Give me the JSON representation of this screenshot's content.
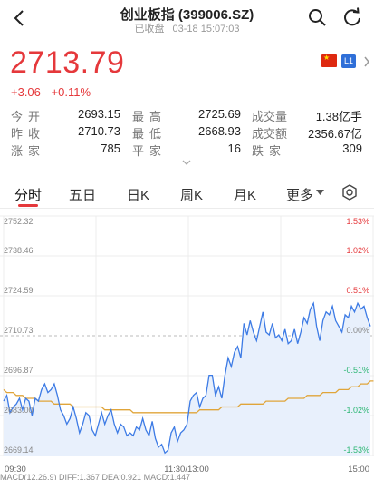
{
  "header": {
    "title": "创业板指 (399006.SZ)",
    "status": "已收盘",
    "datetime": "03-18 15:07:03"
  },
  "quote": {
    "price": "2713.79",
    "change": "+3.06",
    "change_pct": "+0.11%",
    "market_badge": "L1"
  },
  "stats": {
    "open_label": "今开",
    "open": "2693.15",
    "high_label": "最高",
    "high": "2725.69",
    "volume_label": "成交量",
    "volume": "1.38亿手",
    "prev_close_label": "昨收",
    "prev_close": "2710.73",
    "low_label": "最低",
    "low": "2668.93",
    "turnover_label": "成交额",
    "turnover": "2356.67亿",
    "up_label": "涨家",
    "up_count": "785",
    "flat_label": "平家",
    "flat_count": "16",
    "down_label": "跌家",
    "down_count": "309"
  },
  "tabs": [
    "分时",
    "五日",
    "日K",
    "周K",
    "月K",
    "更多"
  ],
  "chart_data": {
    "type": "line",
    "yticks_left": [
      "2752.32",
      "2738.46",
      "2724.59",
      "2710.73",
      "2696.87",
      "2683.00",
      "2669.14"
    ],
    "yticks_right": [
      "1.53%",
      "1.02%",
      "0.51%",
      "0.00%",
      "-0.51%",
      "-1.02%",
      "-1.53%"
    ],
    "xticks": [
      "09:30",
      "11:30/13:00",
      "15:00"
    ],
    "ylim": [
      2669.14,
      2752.32
    ],
    "baseline": 2710.73,
    "series": [
      {
        "values": [
          2688,
          2690,
          2684,
          2686,
          2687,
          2689,
          2685,
          2689,
          2688,
          2683,
          2689,
          2688,
          2692,
          2694,
          2691,
          2692,
          2694,
          2690,
          2685,
          2683,
          2680,
          2682,
          2686,
          2682,
          2677,
          2680,
          2684,
          2683,
          2678,
          2676,
          2680,
          2684,
          2680,
          2683,
          2685,
          2680,
          2677,
          2680,
          2679,
          2676,
          2677,
          2676,
          2679,
          2678,
          2682,
          2678,
          2676,
          2681,
          2675,
          2672,
          2673,
          2670,
          2671,
          2677,
          2679,
          2674,
          2677,
          2678,
          2680,
          2688,
          2690,
          2691,
          2686,
          2689,
          2690,
          2697,
          2697,
          2690,
          2693,
          2689,
          2697,
          2703,
          2700,
          2705,
          2707,
          2703,
          2715,
          2711,
          2716,
          2712,
          2709,
          2714,
          2719,
          2712,
          2711,
          2715,
          2710,
          2711,
          2709,
          2713,
          2708,
          2709,
          2713,
          2708,
          2712,
          2717,
          2715,
          2720,
          2722,
          2714,
          2709,
          2716,
          2719,
          2718,
          2721,
          2716,
          2714,
          2712,
          2718,
          2717,
          2721,
          2719,
          2722,
          2720,
          2721,
          2717,
          2714
        ]
      },
      {
        "values": [
          2692,
          2691,
          2691,
          2691,
          2690,
          2690,
          2690,
          2689,
          2689,
          2689,
          2689,
          2688,
          2688,
          2688,
          2688,
          2688,
          2687,
          2687,
          2687,
          2687,
          2687,
          2687,
          2686,
          2686,
          2686,
          2686,
          2686,
          2686,
          2686,
          2686,
          2686,
          2686,
          2685,
          2685,
          2685,
          2685,
          2685,
          2685,
          2685,
          2685,
          2685,
          2684,
          2684,
          2684,
          2684,
          2684,
          2684,
          2684,
          2684,
          2684,
          2684,
          2684,
          2684,
          2684,
          2684,
          2684,
          2684,
          2684,
          2684,
          2684,
          2684,
          2684,
          2685,
          2685,
          2685,
          2685,
          2685,
          2685,
          2685,
          2686,
          2686,
          2686,
          2686,
          2686,
          2686,
          2687,
          2687,
          2687,
          2687,
          2687,
          2687,
          2687,
          2687,
          2688,
          2688,
          2688,
          2688,
          2688,
          2688,
          2688,
          2689,
          2689,
          2689,
          2689,
          2689,
          2689,
          2690,
          2690,
          2690,
          2690,
          2690,
          2691,
          2691,
          2691,
          2691,
          2691,
          2692,
          2692,
          2692,
          2692,
          2693,
          2693,
          2693,
          2694,
          2694,
          2694,
          2695,
          2695
        ]
      }
    ]
  },
  "indicators": "MACD(12,26,9)  DIFF:1.367  DEA:0.921  MACD:1.447",
  "colors": {
    "up": "#e5383b",
    "line": "#3d7be5",
    "avg": "#e0a53a",
    "fill": "#e8f0fc"
  },
  "icons": [
    "back-icon",
    "search-icon",
    "refresh-icon",
    "china-flag-icon",
    "chevron-right-icon",
    "chevron-down-icon",
    "settings-icon"
  ]
}
